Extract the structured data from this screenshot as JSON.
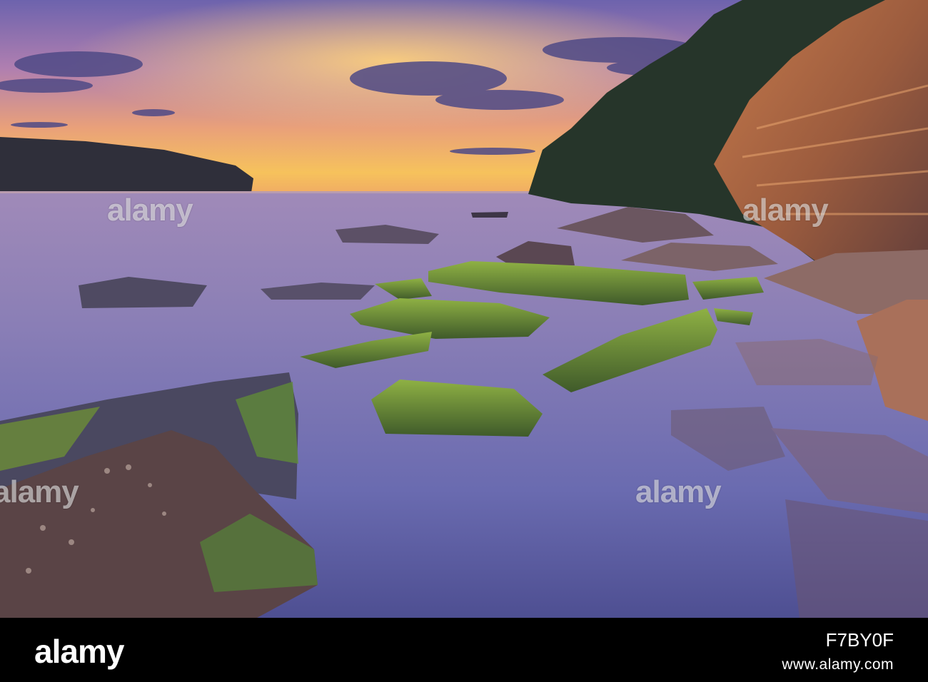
{
  "photo": {
    "watermark_text": "alamy",
    "watermark_slots": 8
  },
  "footer": {
    "logo": "alamy",
    "url": "www.alamy.com",
    "image_code": "F7BY0F"
  },
  "colors": {
    "sky_top": "#6b5fa8",
    "sky_glow": "#f5b35c",
    "sea": "#8a7db4",
    "moss": "#7fa13a",
    "cliff": "#b8704a"
  }
}
